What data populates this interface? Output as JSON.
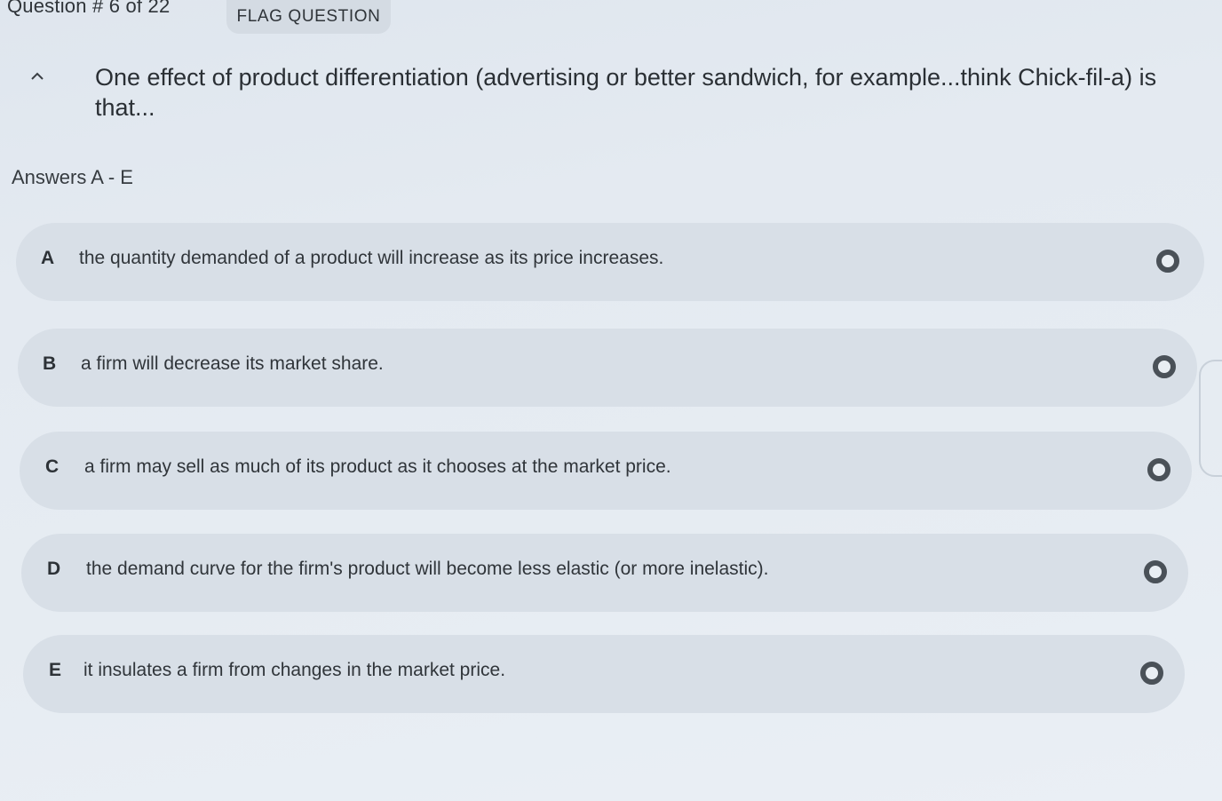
{
  "header": {
    "question_counter": "Question # 6 of 22",
    "flag_label": "FLAG QUESTION"
  },
  "question": {
    "text": "One effect of product differentiation (advertising or better sandwich, for example...think Chick-fil-a) is that..."
  },
  "answers_label": "Answers A - E",
  "options": [
    {
      "letter": "A",
      "text": "the quantity demanded of a product will increase as its price increases."
    },
    {
      "letter": "B",
      "text": "a firm will decrease its market share."
    },
    {
      "letter": "C",
      "text": "a firm may sell as much of its product as it chooses at the market price."
    },
    {
      "letter": "D",
      "text": "the demand curve for the firm's product will become less elastic (or more inelastic)."
    },
    {
      "letter": "E",
      "text": "it insulates a firm from changes in the market price."
    }
  ],
  "icons": {
    "collapse": "chevron-up-icon",
    "radio": "radio-unselected-icon"
  },
  "colors": {
    "option_background": "#d8dfe7",
    "radio_ring": "#4a5158"
  }
}
